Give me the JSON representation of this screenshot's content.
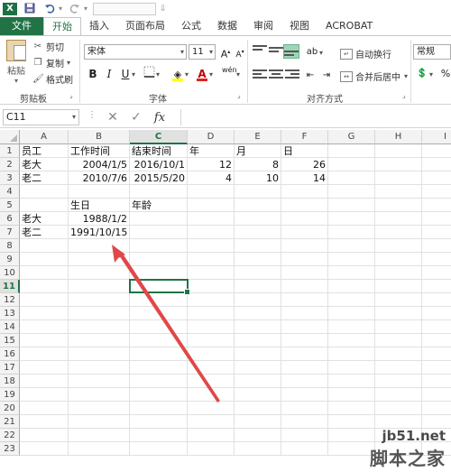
{
  "titlebar": {
    "app_icon": "X",
    "icons": [
      "save-icon",
      "undo-icon",
      "redo-icon"
    ]
  },
  "tabs": [
    {
      "label": "文件"
    },
    {
      "label": "开始"
    },
    {
      "label": "插入"
    },
    {
      "label": "页面布局"
    },
    {
      "label": "公式"
    },
    {
      "label": "数据"
    },
    {
      "label": "审阅"
    },
    {
      "label": "视图"
    },
    {
      "label": "ACROBAT"
    }
  ],
  "ribbon": {
    "clipboard": {
      "paste_label": "粘贴",
      "cut_label": "剪切",
      "copy_label": "复制",
      "format_painter_label": "格式刷",
      "group_label": "剪贴板"
    },
    "font": {
      "font_name": "宋体",
      "font_size": "11",
      "bold": "B",
      "italic": "I",
      "underline": "U",
      "group_label": "字体",
      "grow": "A",
      "shrink": "A",
      "font_color_glyph": "A",
      "wen": "wén"
    },
    "alignment": {
      "wrap_text_label": "自动换行",
      "merge_center_label": "合并后居中",
      "group_label": "对齐方式",
      "orientation": "ab"
    },
    "number": {
      "format": "常规",
      "percent": "%"
    }
  },
  "formula_bar": {
    "name_box": "C11",
    "cancel": "✕",
    "confirm": "✓",
    "fx": "fx",
    "formula": ""
  },
  "grid": {
    "columns": [
      "A",
      "B",
      "C",
      "D",
      "E",
      "F",
      "G",
      "H",
      "I"
    ],
    "rows": [
      "1",
      "2",
      "3",
      "4",
      "5",
      "6",
      "7",
      "8",
      "9",
      "10",
      "11",
      "12",
      "13",
      "14",
      "15",
      "16",
      "17",
      "18",
      "19",
      "20",
      "21",
      "22",
      "23"
    ],
    "selected_column": "C",
    "selected_row": "11",
    "cells": {
      "A1": "员工",
      "B1": "工作时间",
      "C1": "结束时间",
      "D1": "年",
      "E1": "月",
      "F1": "日",
      "A2": "老大",
      "B2": "2004/1/5",
      "C2": "2016/10/1",
      "D2": "12",
      "E2": "8",
      "F2": "26",
      "A3": "老二",
      "B3": "2010/7/6",
      "C3": "2015/5/20",
      "D3": "4",
      "E3": "10",
      "F3": "14",
      "B5": "生日",
      "C5": "年龄",
      "A6": "老大",
      "B6": "1988/1/2",
      "A7": "老二",
      "B7": "1991/10/15"
    }
  },
  "annotation": {
    "arrow_color": "#e04848"
  },
  "watermark": {
    "url": "jb51.net",
    "name": "脚本之家"
  },
  "colors": {
    "excel_green": "#217346",
    "selection": "#217346"
  }
}
